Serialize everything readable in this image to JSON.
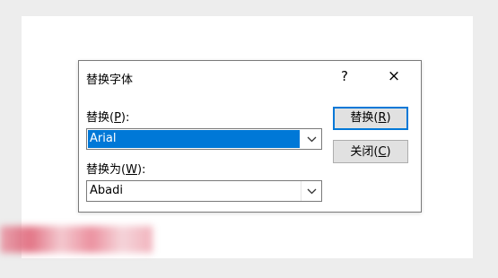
{
  "dialog": {
    "title": "替换字体",
    "help_symbol": "?",
    "close_symbol": "×",
    "replace_label_prefix": "替换(",
    "replace_label_key": "P",
    "replace_label_suffix": "):",
    "replace_value": "Arial",
    "with_label_prefix": "替换为(",
    "with_label_key": "W",
    "with_label_suffix": "):",
    "with_value": "Abadi",
    "replace_button_prefix": "替换(",
    "replace_button_key": "R",
    "replace_button_suffix": ")",
    "close_button_prefix": "关闭(",
    "close_button_key": "C",
    "close_button_suffix": ")"
  },
  "colors": {
    "selection": "#0078d7",
    "default_button_border": "#0078d7",
    "button_face": "#e1e1e1"
  },
  "icons": [
    "help-icon",
    "close-icon",
    "chevron-down-icon"
  ]
}
